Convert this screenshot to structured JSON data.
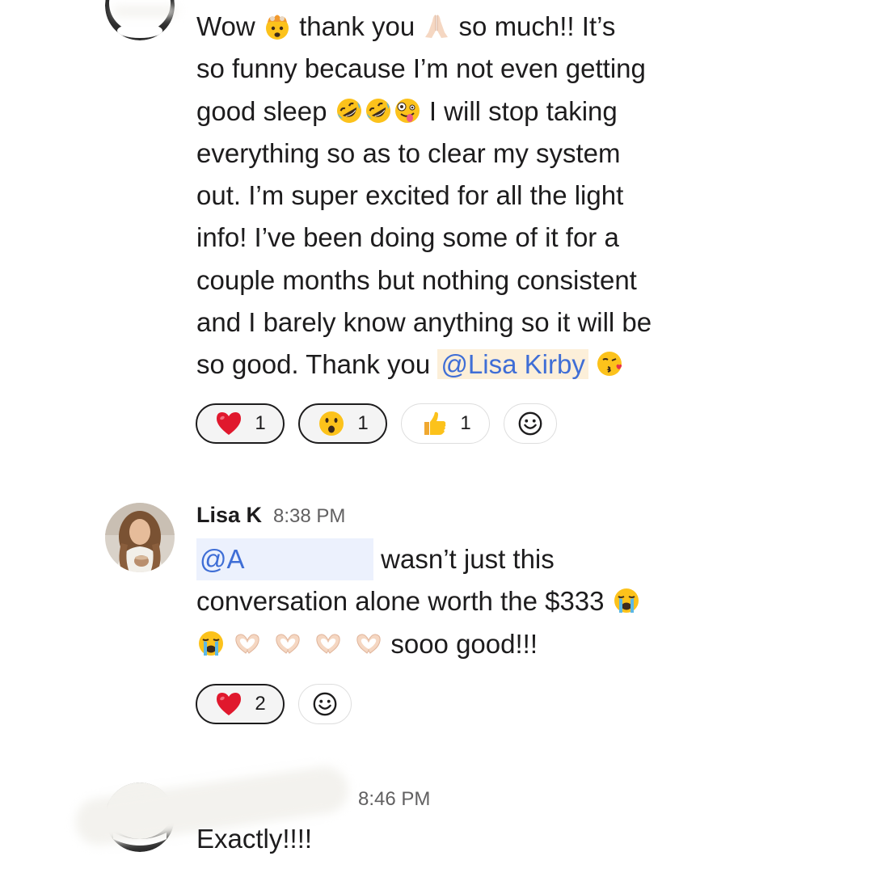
{
  "messages": [
    {
      "id": "m1",
      "sender": "",
      "time": "",
      "lines": [
        "Wow",
        "thank you",
        "so much!! It’s",
        "so funny because I’m not even getting",
        "good sleep",
        "I will stop taking",
        "everything so as to clear my system",
        "out. I’m super excited for all the light",
        "info! I’ve been doing some of it for a",
        "couple months but nothing consistent",
        "and I barely know anything so it will be",
        "so good. Thank you"
      ],
      "mention": "@Lisa Kirby",
      "reactions": [
        {
          "emoji": "heart",
          "count": "1",
          "selected": true
        },
        {
          "emoji": "surprised-face",
          "count": "1",
          "selected": true
        },
        {
          "emoji": "thumbs-up",
          "count": "1",
          "selected": false
        }
      ]
    },
    {
      "id": "m2",
      "sender": "Lisa K",
      "time": "8:38 PM",
      "mention": "@A",
      "line1": "wasn’t just this",
      "line2": "conversation alone worth the $333",
      "line3": "sooo good!!!",
      "reactions": [
        {
          "emoji": "heart",
          "count": "2",
          "selected": true
        }
      ]
    },
    {
      "id": "m3",
      "sender": "",
      "time": "8:46 PM",
      "text": "Exactly!!!!"
    }
  ],
  "colors": {
    "text": "#1d1c1d",
    "timestamp": "#616061",
    "mention": "#3f6ed6",
    "mention_bg": "#fcefd9"
  }
}
